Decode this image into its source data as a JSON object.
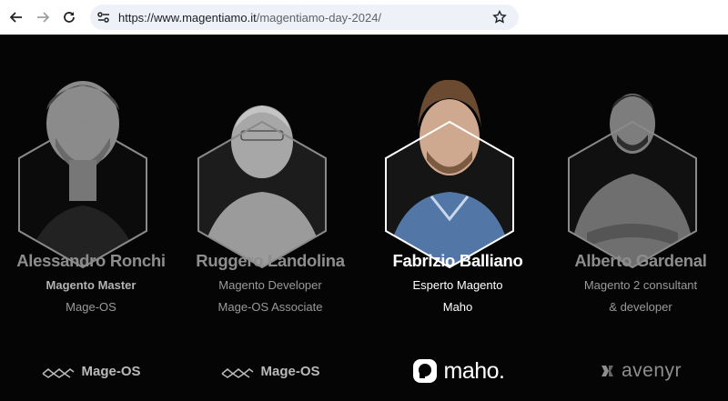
{
  "browser": {
    "url_host": "https://www.magentiamo.it",
    "url_path": "/magentiamo-day-2024/",
    "icons": {
      "back": "back-arrow-icon",
      "forward": "forward-arrow-icon",
      "reload": "reload-icon",
      "site_info": "tune-icon",
      "bookmark": "star-icon"
    }
  },
  "speakers": [
    {
      "name": "Alessandro Ronchi",
      "role": "Magento Master",
      "role2": "Mage-OS",
      "logo": "Mage-OS",
      "logo_icon": "mage-os-logo-icon"
    },
    {
      "name": "Ruggero Landolina",
      "role": "Magento Developer",
      "role2": "Mage-OS Associate",
      "logo": "Mage-OS",
      "logo_icon": "mage-os-logo-icon"
    },
    {
      "name": "Fabrizio Balliano",
      "role": "Esperto Magento",
      "role2": "Maho",
      "logo": "maho.",
      "logo_icon": "maho-logo-icon"
    },
    {
      "name": "Alberto Gardenal",
      "role": "Magento 2 consultant",
      "role2": "& developer",
      "logo": "avenyr",
      "logo_icon": "avenyr-logo-icon"
    }
  ],
  "colors": {
    "background": "#050505",
    "active_text": "#ffffff",
    "inactive_text": "#8d8d8d",
    "hexagon_border": "#8a8a8a",
    "active_hexagon_border": "#ffffff"
  }
}
